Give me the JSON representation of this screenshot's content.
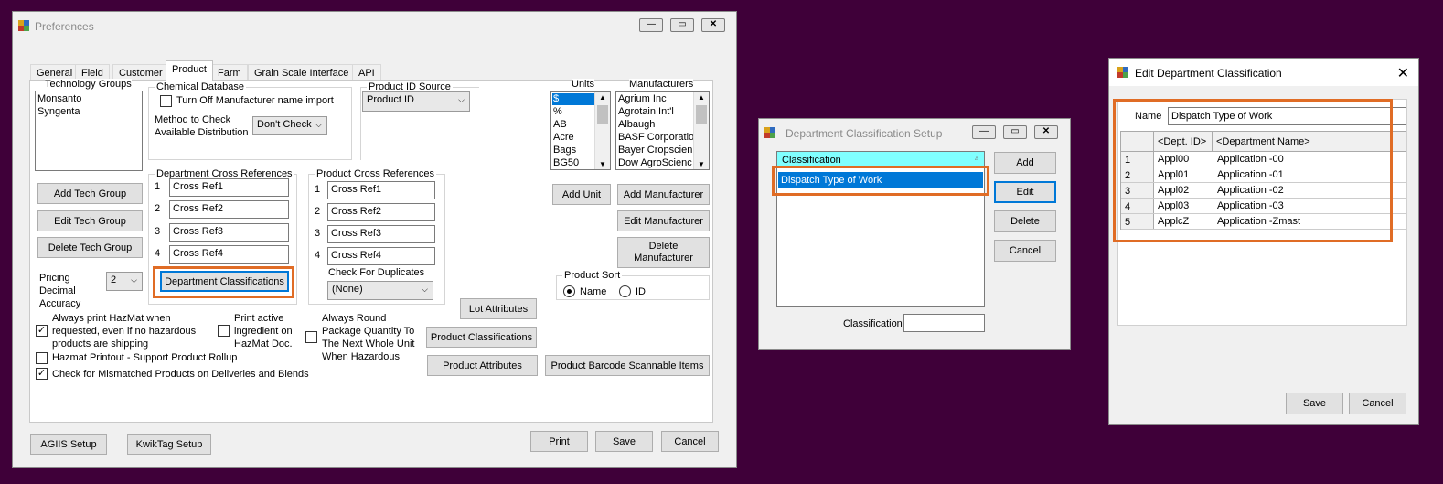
{
  "prefs": {
    "title": "Preferences",
    "tabs": [
      "General",
      "Field",
      "Customer",
      "Product",
      "Farm",
      "Grain Scale Interface",
      "API"
    ],
    "tech_groups": {
      "label": "Technology Groups",
      "items": [
        "Monsanto",
        "Syngenta"
      ]
    },
    "tech_buttons": [
      "Add Tech Group",
      "Edit Tech Group",
      "Delete Tech Group"
    ],
    "pricing": {
      "label": "Pricing Decimal Accuracy",
      "value": "2"
    },
    "chemical": {
      "label": "Chemical Database",
      "turn_off": "Turn Off Manufacturer name import",
      "method_label": "Method to Check Available Distribution",
      "method_value": "Don't Check"
    },
    "product_id_source": {
      "label": "Product ID Source",
      "value": "Product ID"
    },
    "dept_xref": {
      "label": "Department Cross References",
      "nums": [
        "1",
        "2",
        "3",
        "4"
      ],
      "values": [
        "Cross Ref1",
        "Cross Ref2",
        "Cross Ref3",
        "Cross Ref4"
      ],
      "button": "Department Classifications"
    },
    "prod_xref": {
      "label": "Product Cross References",
      "nums": [
        "1",
        "2",
        "3",
        "4"
      ],
      "values": [
        "Cross Ref1",
        "Cross Ref2",
        "Cross Ref3",
        "Cross Ref4"
      ],
      "dup_label": "Check For Duplicates",
      "dup_value": "(None)"
    },
    "units": {
      "label": "Units",
      "items": [
        "$",
        "%",
        "AB",
        "Acre",
        "Bags",
        "BG50"
      ],
      "add": "Add Unit"
    },
    "manufacturers": {
      "label": "Manufacturers",
      "items": [
        "Agrium Inc",
        "Agrotain Int'l",
        "Albaugh",
        "BASF Corporatio",
        "Bayer Cropscien",
        "Dow AgroScienc"
      ],
      "add": "Add Manufacturer",
      "edit": "Edit Manufacturer",
      "delete": "Delete Manufacturer"
    },
    "product_sort": {
      "label": "Product Sort",
      "name": "Name",
      "id": "ID"
    },
    "checks": {
      "hazmat": "Always print HazMat when requested, even if no hazardous products are shipping",
      "active": "Print active ingredient on HazMat Doc.",
      "round": "Always Round Package Quantity To The Next Whole Unit When Hazardous",
      "rollup": "Hazmat Printout - Support Product Rollup",
      "mismatch": "Check for Mismatched Products on Deliveries and Blends"
    },
    "mid_buttons": {
      "lot": "Lot Attributes",
      "classifications": "Product Classifications",
      "attributes": "Product Attributes",
      "barcode": "Product Barcode Scannable Items"
    },
    "footer": {
      "agiis": "AGIIS Setup",
      "kwiktag": "KwikTag Setup",
      "print": "Print",
      "save": "Save",
      "cancel": "Cancel"
    }
  },
  "dcs": {
    "title": "Department Classification Setup",
    "header": "Classification",
    "selected": "Dispatch Type of Work",
    "buttons": [
      "Add",
      "Edit",
      "Delete",
      "Cancel"
    ],
    "field_label": "Classification"
  },
  "edc": {
    "title": "Edit Department Classification",
    "name_label": "Name",
    "name_value": "Dispatch Type of Work",
    "columns": [
      "<Dept. ID>",
      "<Department Name>"
    ],
    "rows": [
      {
        "n": "1",
        "id": "Appl00",
        "name": "Application -00"
      },
      {
        "n": "2",
        "id": "Appl01",
        "name": "Application -01"
      },
      {
        "n": "3",
        "id": "Appl02",
        "name": "Application -02"
      },
      {
        "n": "4",
        "id": "Appl03",
        "name": "Application -03"
      },
      {
        "n": "5",
        "id": "ApplcZ",
        "name": "Application -Zmast"
      }
    ],
    "save": "Save",
    "cancel": "Cancel"
  },
  "colors": {
    "highlight": "#e06c25",
    "select": "#0078d7",
    "header": "#80ffff"
  }
}
